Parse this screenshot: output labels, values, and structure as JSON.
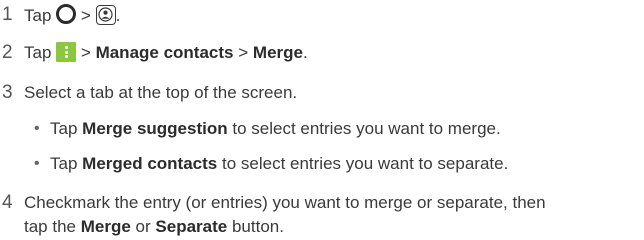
{
  "steps": [
    {
      "num": "1",
      "parts": [
        "Tap",
        ">",
        "."
      ]
    },
    {
      "num": "2",
      "parts": [
        "Tap",
        ">",
        "Manage contacts",
        ">",
        "Merge",
        "."
      ]
    },
    {
      "num": "3",
      "text": "Select a tab at the top of the screen."
    },
    {
      "num": "4",
      "line1": "Checkmark the entry (or entries) you want to merge or separate, then",
      "line2_parts": [
        "tap the",
        "Merge",
        "or",
        "Separate",
        "button."
      ]
    }
  ],
  "bullets": [
    {
      "prefix": "Tap",
      "bold": "Merge suggestion",
      "suffix": "to select entries you want to merge."
    },
    {
      "prefix": "Tap",
      "bold": "Merged contacts",
      "suffix": "to select entries you want to separate."
    }
  ],
  "icons": {
    "home": "home-ring-icon",
    "contacts": "contacts-app-icon",
    "menu": "more-options-icon",
    "menu_color": "#8dc63f"
  }
}
